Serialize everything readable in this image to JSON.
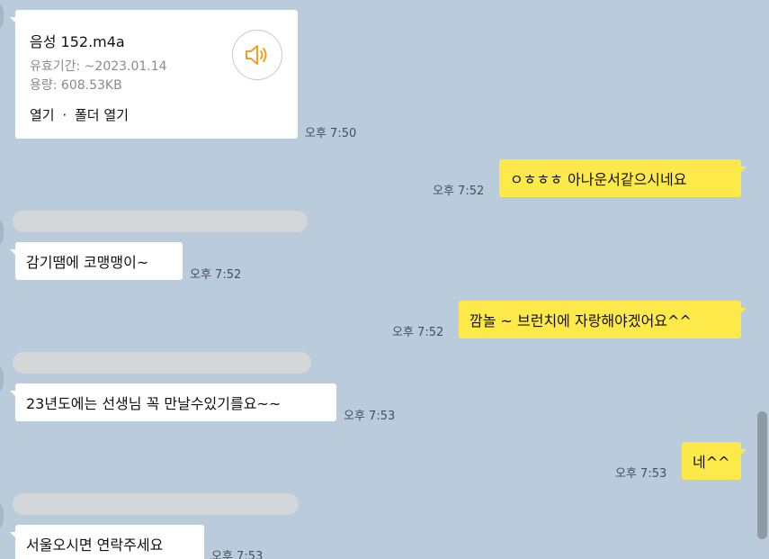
{
  "file_message": {
    "name": "음성 152.m4a",
    "expiry": "유효기간: ~2023.01.14",
    "size": "용량: 608.53KB",
    "open_label": "열기",
    "separator": "·",
    "open_folder_label": "폴더 열기",
    "icon": "speaker-icon",
    "time": "오후 7:50"
  },
  "messages": [
    {
      "direction": "outgoing",
      "text": "ㅇㅎㅎㅎ 아나운서같으시네요",
      "time": "오후 7:52"
    },
    {
      "direction": "incoming",
      "text": "감기땜에 코맹맹이~",
      "time": "오후 7:52"
    },
    {
      "direction": "outgoing",
      "text": "깜놀 ~ 브런치에 자랑해야겠어요^^",
      "time": "오후 7:52"
    },
    {
      "direction": "incoming",
      "text": "23년도에는 선생님 꼭 만날수있기를요~~",
      "time": "오후 7:53"
    },
    {
      "direction": "outgoing",
      "text": "네^^",
      "time": "오후 7:53"
    },
    {
      "direction": "incoming",
      "text": "서울오시면 연락주세요",
      "time": "오후 7:53"
    }
  ],
  "colors": {
    "background": "#bacbdc",
    "outgoing_bubble": "#fee94b",
    "incoming_bubble": "#ffffff",
    "accent_icon": "#f0a020"
  }
}
